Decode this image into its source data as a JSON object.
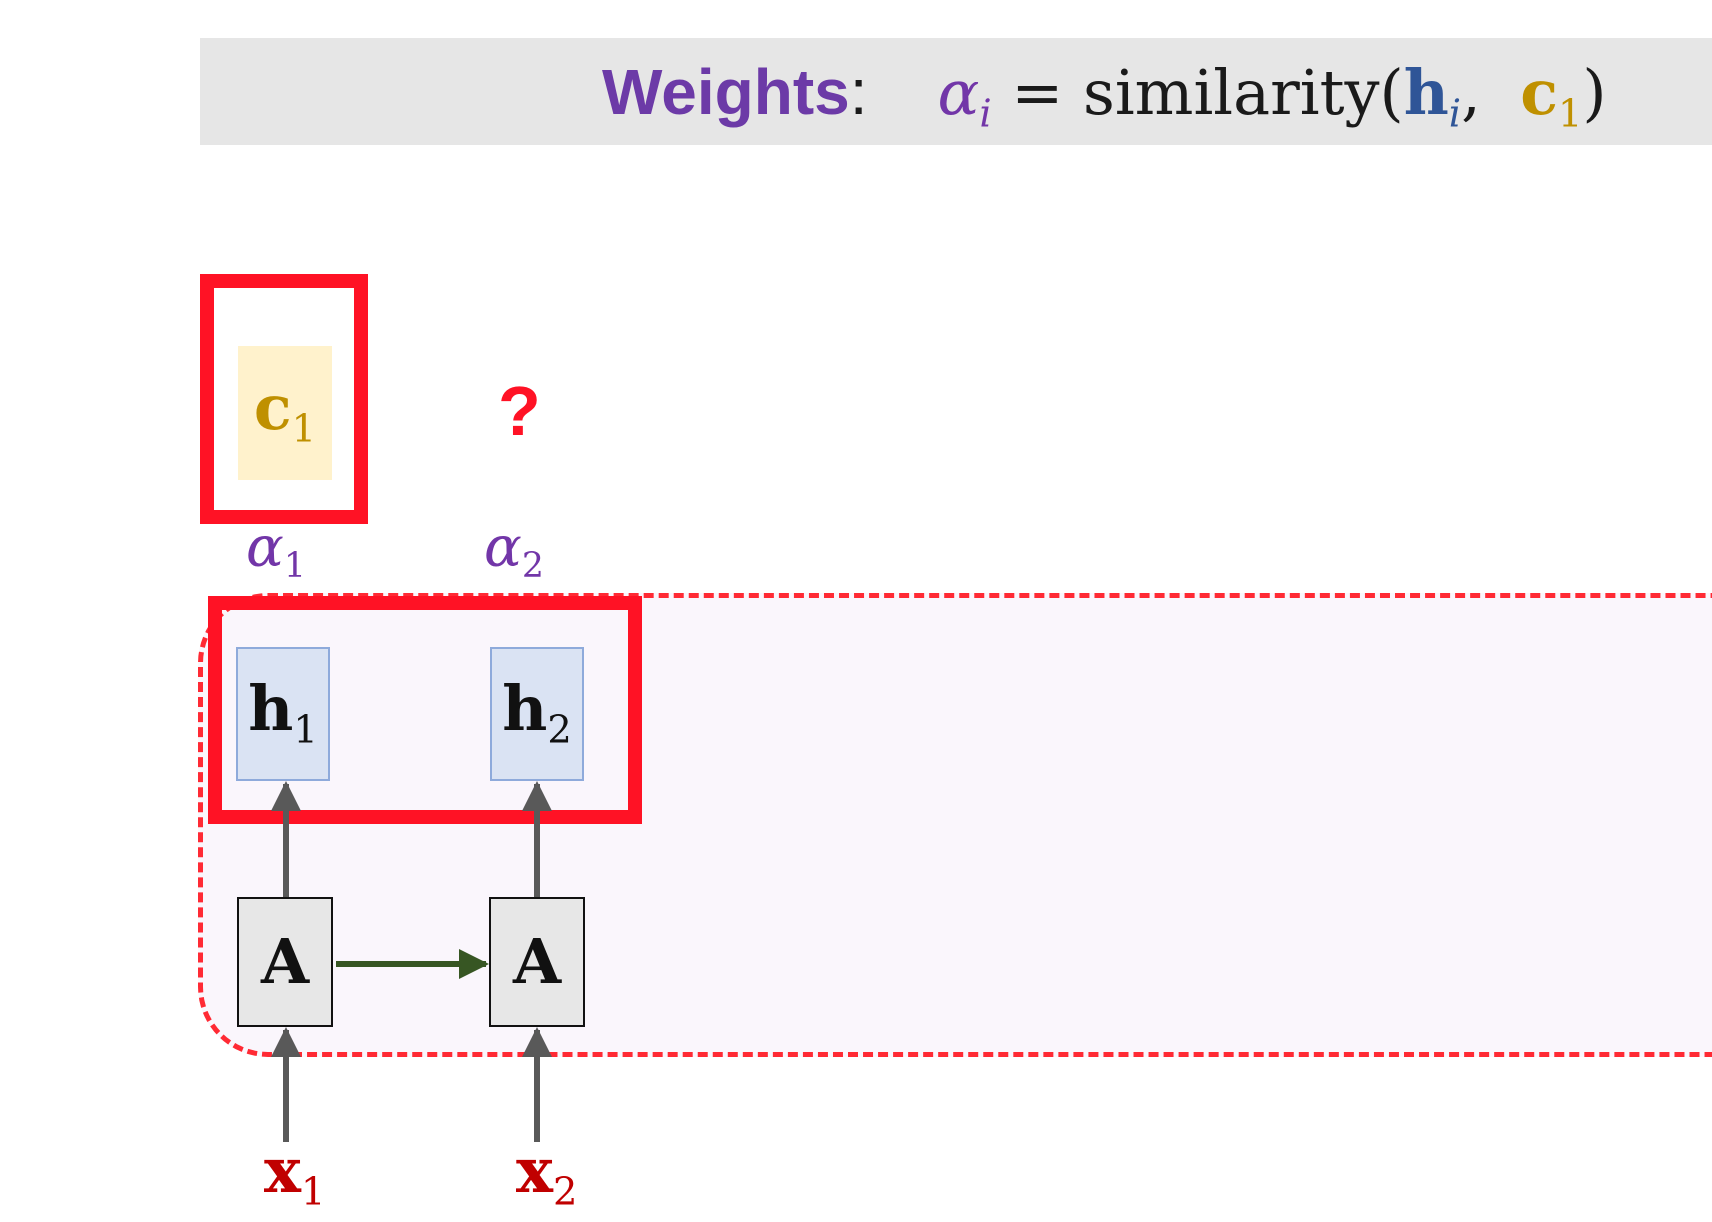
{
  "formula": {
    "prefix": "Weights",
    "colon": ":",
    "alpha": "α",
    "alpha_sub": "i",
    "equals": " = similarity(",
    "h": "h",
    "h_sub": "i",
    "comma": ",  ",
    "c": "c",
    "c_sub": "1",
    "close": ")"
  },
  "question_mark": "?",
  "context": {
    "symbol": "c",
    "sub": "1"
  },
  "weights": [
    {
      "symbol": "α",
      "sub": "1"
    },
    {
      "symbol": "α",
      "sub": "2"
    }
  ],
  "hidden_states": [
    {
      "symbol": "h",
      "sub": "1"
    },
    {
      "symbol": "h",
      "sub": "2"
    }
  ],
  "cells": [
    {
      "symbol": "A"
    },
    {
      "symbol": "A"
    }
  ],
  "inputs": [
    {
      "symbol": "x",
      "sub": "1"
    },
    {
      "symbol": "x",
      "sub": "2"
    }
  ],
  "colors": {
    "weight_purple": "#7236a8",
    "hidden_blue": "#2f5597",
    "context_gold": "#bf9000",
    "input_red": "#c00000",
    "highlight_red": "#ff1225",
    "arrow_gray": "#595959",
    "arrow_green": "#375623"
  }
}
